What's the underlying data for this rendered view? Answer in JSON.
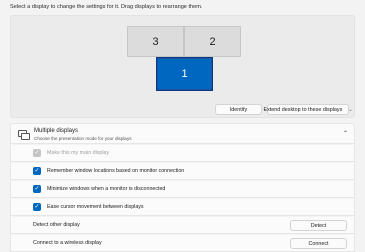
{
  "instruction": "Select a display to change the settings for it. Drag displays to rearrange them.",
  "monitors": [
    {
      "label": "3"
    },
    {
      "label": "2"
    },
    {
      "label": "1",
      "selected": true
    }
  ],
  "identify_button": "Identify",
  "extend_dropdown": {
    "value": "Extend desktop to these displays"
  },
  "multiple_displays": {
    "title": "Multiple displays",
    "subtitle": "Choose the presentation mode for your displays",
    "expanded": true,
    "options": [
      {
        "label": "Make this my main display",
        "checked": true,
        "disabled": true
      },
      {
        "label": "Remember window locations based on monitor connection",
        "checked": true
      },
      {
        "label": "Minimize windows when a monitor is disconnected",
        "checked": true
      },
      {
        "label": "Ease cursor movement between displays",
        "checked": true
      }
    ],
    "detect": {
      "label": "Detect other display",
      "button": "Detect"
    },
    "connect": {
      "label": "Connect to a wireless display",
      "button": "Connect"
    }
  },
  "colors": {
    "accent": "#0067c0",
    "background": "#f3f3f3"
  }
}
